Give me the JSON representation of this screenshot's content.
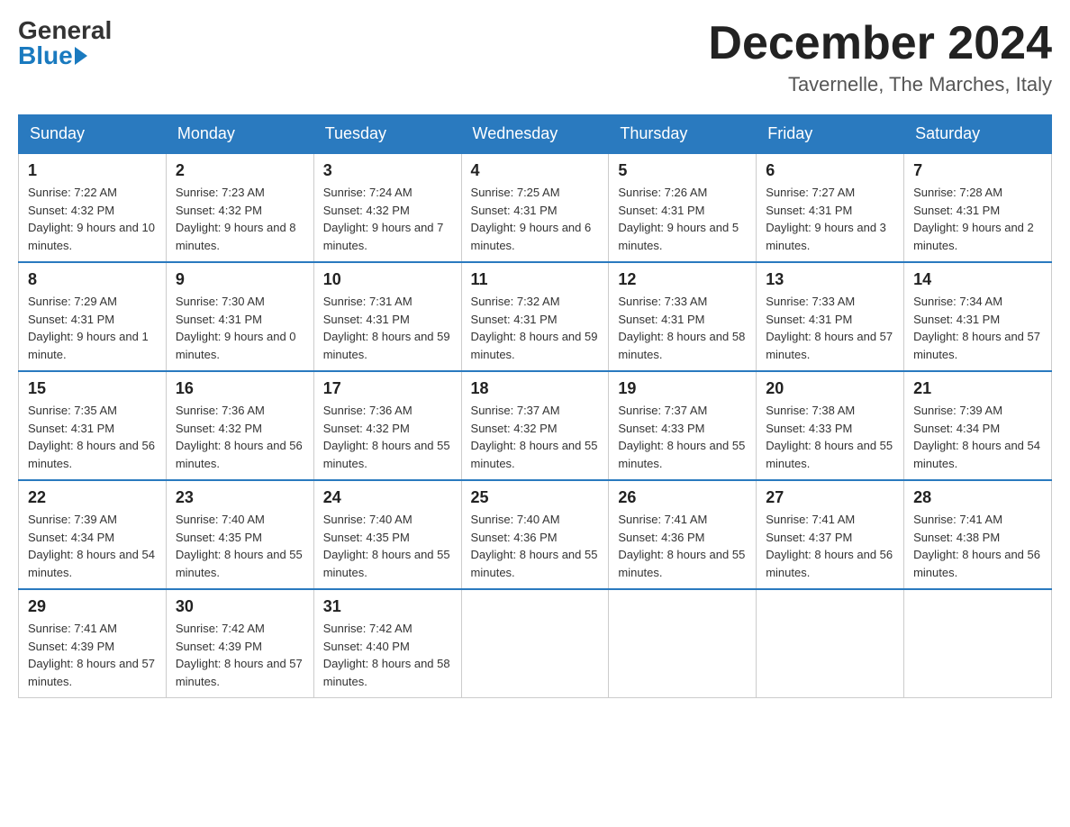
{
  "header": {
    "logo_general": "General",
    "logo_blue": "Blue",
    "month_title": "December 2024",
    "location": "Tavernelle, The Marches, Italy"
  },
  "days_of_week": [
    "Sunday",
    "Monday",
    "Tuesday",
    "Wednesday",
    "Thursday",
    "Friday",
    "Saturday"
  ],
  "weeks": [
    [
      {
        "day": "1",
        "sunrise": "7:22 AM",
        "sunset": "4:32 PM",
        "daylight": "9 hours and 10 minutes."
      },
      {
        "day": "2",
        "sunrise": "7:23 AM",
        "sunset": "4:32 PM",
        "daylight": "9 hours and 8 minutes."
      },
      {
        "day": "3",
        "sunrise": "7:24 AM",
        "sunset": "4:32 PM",
        "daylight": "9 hours and 7 minutes."
      },
      {
        "day": "4",
        "sunrise": "7:25 AM",
        "sunset": "4:31 PM",
        "daylight": "9 hours and 6 minutes."
      },
      {
        "day": "5",
        "sunrise": "7:26 AM",
        "sunset": "4:31 PM",
        "daylight": "9 hours and 5 minutes."
      },
      {
        "day": "6",
        "sunrise": "7:27 AM",
        "sunset": "4:31 PM",
        "daylight": "9 hours and 3 minutes."
      },
      {
        "day": "7",
        "sunrise": "7:28 AM",
        "sunset": "4:31 PM",
        "daylight": "9 hours and 2 minutes."
      }
    ],
    [
      {
        "day": "8",
        "sunrise": "7:29 AM",
        "sunset": "4:31 PM",
        "daylight": "9 hours and 1 minute."
      },
      {
        "day": "9",
        "sunrise": "7:30 AM",
        "sunset": "4:31 PM",
        "daylight": "9 hours and 0 minutes."
      },
      {
        "day": "10",
        "sunrise": "7:31 AM",
        "sunset": "4:31 PM",
        "daylight": "8 hours and 59 minutes."
      },
      {
        "day": "11",
        "sunrise": "7:32 AM",
        "sunset": "4:31 PM",
        "daylight": "8 hours and 59 minutes."
      },
      {
        "day": "12",
        "sunrise": "7:33 AM",
        "sunset": "4:31 PM",
        "daylight": "8 hours and 58 minutes."
      },
      {
        "day": "13",
        "sunrise": "7:33 AM",
        "sunset": "4:31 PM",
        "daylight": "8 hours and 57 minutes."
      },
      {
        "day": "14",
        "sunrise": "7:34 AM",
        "sunset": "4:31 PM",
        "daylight": "8 hours and 57 minutes."
      }
    ],
    [
      {
        "day": "15",
        "sunrise": "7:35 AM",
        "sunset": "4:31 PM",
        "daylight": "8 hours and 56 minutes."
      },
      {
        "day": "16",
        "sunrise": "7:36 AM",
        "sunset": "4:32 PM",
        "daylight": "8 hours and 56 minutes."
      },
      {
        "day": "17",
        "sunrise": "7:36 AM",
        "sunset": "4:32 PM",
        "daylight": "8 hours and 55 minutes."
      },
      {
        "day": "18",
        "sunrise": "7:37 AM",
        "sunset": "4:32 PM",
        "daylight": "8 hours and 55 minutes."
      },
      {
        "day": "19",
        "sunrise": "7:37 AM",
        "sunset": "4:33 PM",
        "daylight": "8 hours and 55 minutes."
      },
      {
        "day": "20",
        "sunrise": "7:38 AM",
        "sunset": "4:33 PM",
        "daylight": "8 hours and 55 minutes."
      },
      {
        "day": "21",
        "sunrise": "7:39 AM",
        "sunset": "4:34 PM",
        "daylight": "8 hours and 54 minutes."
      }
    ],
    [
      {
        "day": "22",
        "sunrise": "7:39 AM",
        "sunset": "4:34 PM",
        "daylight": "8 hours and 54 minutes."
      },
      {
        "day": "23",
        "sunrise": "7:40 AM",
        "sunset": "4:35 PM",
        "daylight": "8 hours and 55 minutes."
      },
      {
        "day": "24",
        "sunrise": "7:40 AM",
        "sunset": "4:35 PM",
        "daylight": "8 hours and 55 minutes."
      },
      {
        "day": "25",
        "sunrise": "7:40 AM",
        "sunset": "4:36 PM",
        "daylight": "8 hours and 55 minutes."
      },
      {
        "day": "26",
        "sunrise": "7:41 AM",
        "sunset": "4:36 PM",
        "daylight": "8 hours and 55 minutes."
      },
      {
        "day": "27",
        "sunrise": "7:41 AM",
        "sunset": "4:37 PM",
        "daylight": "8 hours and 56 minutes."
      },
      {
        "day": "28",
        "sunrise": "7:41 AM",
        "sunset": "4:38 PM",
        "daylight": "8 hours and 56 minutes."
      }
    ],
    [
      {
        "day": "29",
        "sunrise": "7:41 AM",
        "sunset": "4:39 PM",
        "daylight": "8 hours and 57 minutes."
      },
      {
        "day": "30",
        "sunrise": "7:42 AM",
        "sunset": "4:39 PM",
        "daylight": "8 hours and 57 minutes."
      },
      {
        "day": "31",
        "sunrise": "7:42 AM",
        "sunset": "4:40 PM",
        "daylight": "8 hours and 58 minutes."
      },
      null,
      null,
      null,
      null
    ]
  ],
  "labels": {
    "sunrise": "Sunrise:",
    "sunset": "Sunset:",
    "daylight": "Daylight:"
  }
}
